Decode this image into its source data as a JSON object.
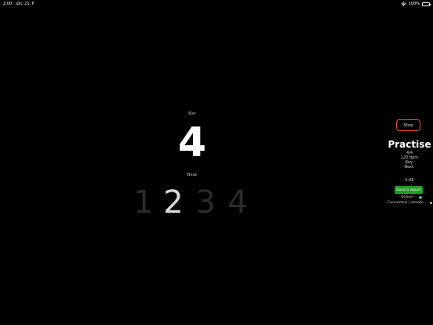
{
  "status_bar": {
    "time": "2:00",
    "date": "jún. 21. P",
    "battery": "100%"
  },
  "metronome": {
    "bar_label": "Bar",
    "bar_number": "4",
    "beat_label": "Beat",
    "beats": [
      "1",
      "2",
      "3",
      "4"
    ],
    "active_beat": 2
  },
  "panel": {
    "stop_label": "Stop",
    "song_title": "Practise",
    "time_signature": "4/4",
    "tempo": "120 bpm",
    "key": "Key:",
    "next": "Next:",
    "elapsed": "0:06",
    "report_label": "Send a report",
    "online_label": "- Online -",
    "remote_label": "- Connected | remote -"
  },
  "colors": {
    "background": "#000000",
    "stop_border": "#e0483e",
    "report_button": "#1f9e1f",
    "status_dot": "#7fd67f"
  }
}
